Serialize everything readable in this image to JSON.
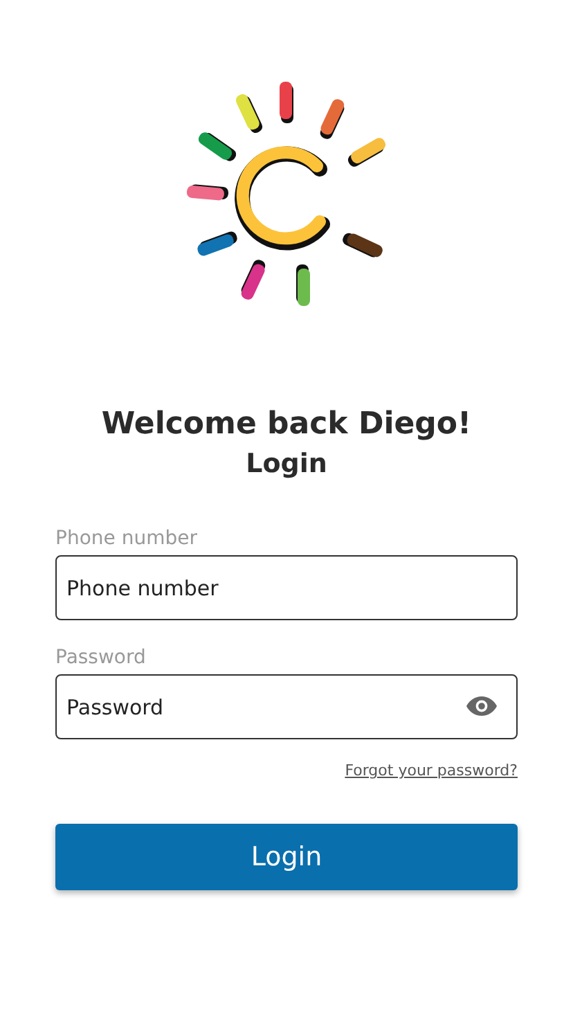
{
  "greeting": "Welcome back Diego!",
  "heading": "Login",
  "fields": [
    {
      "kind": "phone",
      "label": "Phone number",
      "placeholder": "Phone number"
    },
    {
      "kind": "password",
      "label": "Password",
      "placeholder": "Password"
    }
  ],
  "forgot_link": "Forgot your password?",
  "login_button": "Login"
}
